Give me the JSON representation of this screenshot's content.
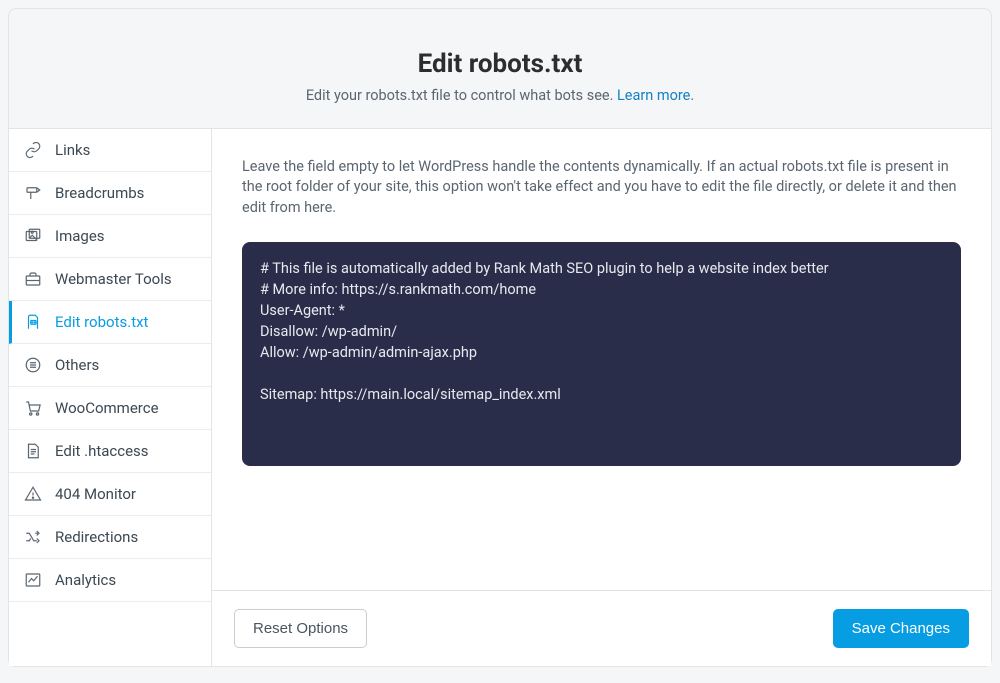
{
  "header": {
    "title": "Edit robots.txt",
    "subtitle_pre": "Edit your robots.txt file to control what bots see. ",
    "learn_more": "Learn more"
  },
  "sidebar": {
    "items": [
      {
        "label": "Links",
        "icon": "link-icon"
      },
      {
        "label": "Breadcrumbs",
        "icon": "signpost-icon"
      },
      {
        "label": "Images",
        "icon": "images-icon"
      },
      {
        "label": "Webmaster Tools",
        "icon": "toolbox-icon"
      },
      {
        "label": "Edit robots.txt",
        "icon": "robots-file-icon"
      },
      {
        "label": "Others",
        "icon": "list-icon"
      },
      {
        "label": "WooCommerce",
        "icon": "cart-icon"
      },
      {
        "label": "Edit .htaccess",
        "icon": "file-icon"
      },
      {
        "label": "404 Monitor",
        "icon": "warning-icon"
      },
      {
        "label": "Redirections",
        "icon": "shuffle-icon"
      },
      {
        "label": "Analytics",
        "icon": "chart-icon"
      }
    ]
  },
  "content": {
    "description": "Leave the field empty to let WordPress handle the contents dynamically. If an actual robots.txt file is present in the root folder of your site, this option won't take effect and you have to edit the file directly, or delete it and then edit from here.",
    "editor_value": "# This file is automatically added by Rank Math SEO plugin to help a website index better\n# More info: https://s.rankmath.com/home\nUser-Agent: *\nDisallow: /wp-admin/\nAllow: /wp-admin/admin-ajax.php\n\nSitemap: https://main.local/sitemap_index.xml"
  },
  "footer": {
    "reset_label": "Reset Options",
    "save_label": "Save Changes"
  },
  "colors": {
    "accent": "#069de3",
    "editor_bg": "#2a2d4a"
  }
}
